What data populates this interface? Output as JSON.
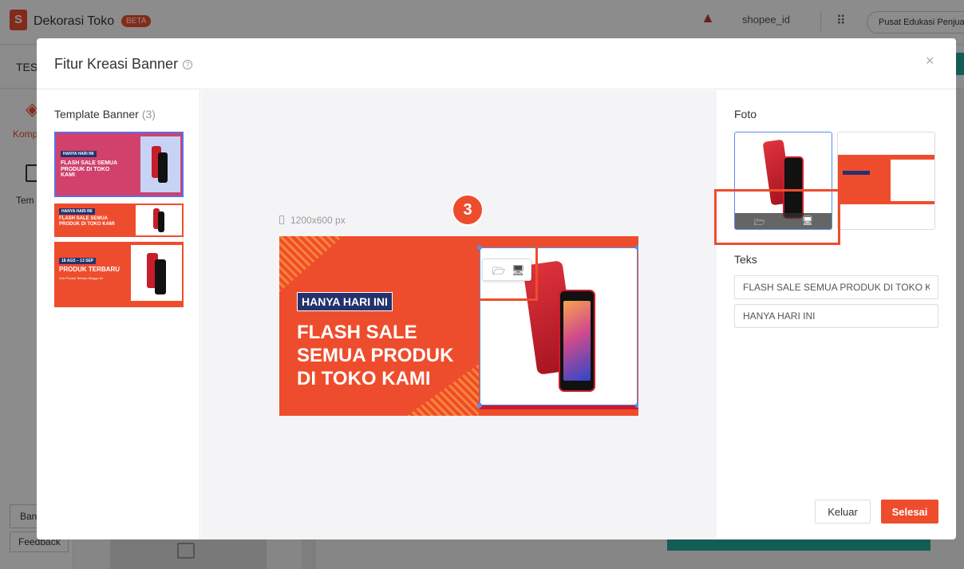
{
  "app": {
    "title": "Dekorasi Toko",
    "badge": "BETA",
    "username": "shopee_id",
    "edu_button": "Pusat Edukasi Penjual",
    "shop_label": "TES",
    "sidebar_komp": "Komp",
    "sidebar_tem": "Tem",
    "ban_button": "Ban",
    "feedback_button": "Feedback"
  },
  "modal": {
    "title": "Fitur Kreasi Banner",
    "close_symbol": "×"
  },
  "template_panel": {
    "heading": "Template Banner",
    "count": "(3)",
    "templates": [
      {
        "tag": "HANYA HARI INI",
        "headline": "FLASH SALE SEMUA PRODUK DI TOKO KAMI"
      },
      {
        "tag": "HANYA HARI INI",
        "headline": "FLASH SALE SEMUA PRODUK DI TOKO KAMI"
      },
      {
        "tag": "18 AGS – 13 SEP",
        "headline": "PRODUK TERBARU",
        "sub": "Cek Produk Terbaru Minggu Ini"
      }
    ]
  },
  "canvas": {
    "size_label": "1200x600 px",
    "banner_tag": "HANYA HARI INI",
    "banner_headline": "FLASH SALE SEMUA PRODUK DI TOKO KAMI",
    "step_number": "3"
  },
  "right_panel": {
    "photo_heading": "Foto",
    "text_heading": "Teks",
    "text_field_1": "FLASH SALE SEMUA PRODUK DI TOKO KAMI",
    "text_field_2": "HANYA HARI INI",
    "cancel_label": "Keluar",
    "done_label": "Selesai"
  },
  "colors": {
    "brand": "#ee4d2d",
    "navy": "#23326e",
    "selection": "#5b8def"
  },
  "icons": [
    "shopee-logo-icon",
    "help-icon",
    "close-icon",
    "image-upload-icon",
    "desktop-icon",
    "apps-grid-icon"
  ]
}
